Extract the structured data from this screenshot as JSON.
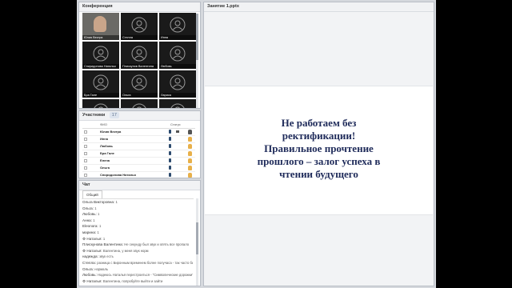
{
  "conference": {
    "title": "Конференция",
    "tiles": [
      {
        "name": "Юлия Вектра",
        "camera": true
      },
      {
        "name": "Стелла",
        "camera": false
      },
      {
        "name": "Инна",
        "camera": false
      },
      {
        "name": "Спиридонова Наталья",
        "camera": false
      },
      {
        "name": "Плискунов Валентина",
        "camera": false
      },
      {
        "name": "Любовь",
        "camera": false
      },
      {
        "name": "Бра Гале",
        "camera": false
      },
      {
        "name": "Ольга",
        "camera": false
      },
      {
        "name": "Лариса",
        "camera": false
      },
      {
        "name": "",
        "camera": false
      },
      {
        "name": "",
        "camera": false
      },
      {
        "name": "",
        "camera": false
      }
    ]
  },
  "participants": {
    "title": "Участники",
    "count": "17",
    "col_fio": "ФИО",
    "col_status": "Статус",
    "rows": [
      {
        "name": "Юлия Вектра",
        "mic": true,
        "cam": true,
        "dark": true
      },
      {
        "name": "Инна",
        "mic": true,
        "cam": false,
        "dark": false
      },
      {
        "name": "Любовь",
        "mic": true,
        "cam": false,
        "dark": false
      },
      {
        "name": "Бра Гале",
        "mic": true,
        "cam": false,
        "dark": false
      },
      {
        "name": "Елена",
        "mic": true,
        "cam": false,
        "dark": false
      },
      {
        "name": "Ольга",
        "mic": true,
        "cam": false,
        "dark": false
      },
      {
        "name": "Спиридонова Наталья",
        "mic": true,
        "cam": false,
        "dark": false
      }
    ]
  },
  "chat": {
    "title": "Чат",
    "tab": "Общий",
    "messages": [
      {
        "author": "Ольга Викторовна:",
        "text": "1"
      },
      {
        "author": "Ольга:",
        "text": "1"
      },
      {
        "author": "Любовь:",
        "text": "1"
      },
      {
        "author": "Анна:",
        "text": "1"
      },
      {
        "author": "Eleonora:",
        "text": "1"
      },
      {
        "author": "марина:",
        "text": "1"
      },
      {
        "author": "⚙ Наталья:",
        "text": "1"
      },
      {
        "author": "Плискунова Валентина:",
        "text": "Не секунду был звук и опять все пропало"
      },
      {
        "author": "⚙ Наталья:",
        "text": "Валентина, у меня звук норм"
      },
      {
        "author": "надежда:",
        "text": "звук есть"
      },
      {
        "author": "Стелла:",
        "text": "разница с Биронным временем более получаса - так часто бывает?"
      },
      {
        "author": "Ольга:",
        "text": "нормаль"
      },
      {
        "author": "Любовь:",
        "text": "Надеюсь Наталья перестроиться - \"Символические дорожки\""
      },
      {
        "author": "⚙ Наталья:",
        "text": "Валентина, попробуйте выйти и зайти"
      }
    ]
  },
  "presentation": {
    "title": "Занятие 1.pptx",
    "lines": [
      "Не работаем без",
      "ректификации!",
      "Правильное прочтение",
      "прошлого – залог успеха в",
      "чтении будущего"
    ]
  }
}
